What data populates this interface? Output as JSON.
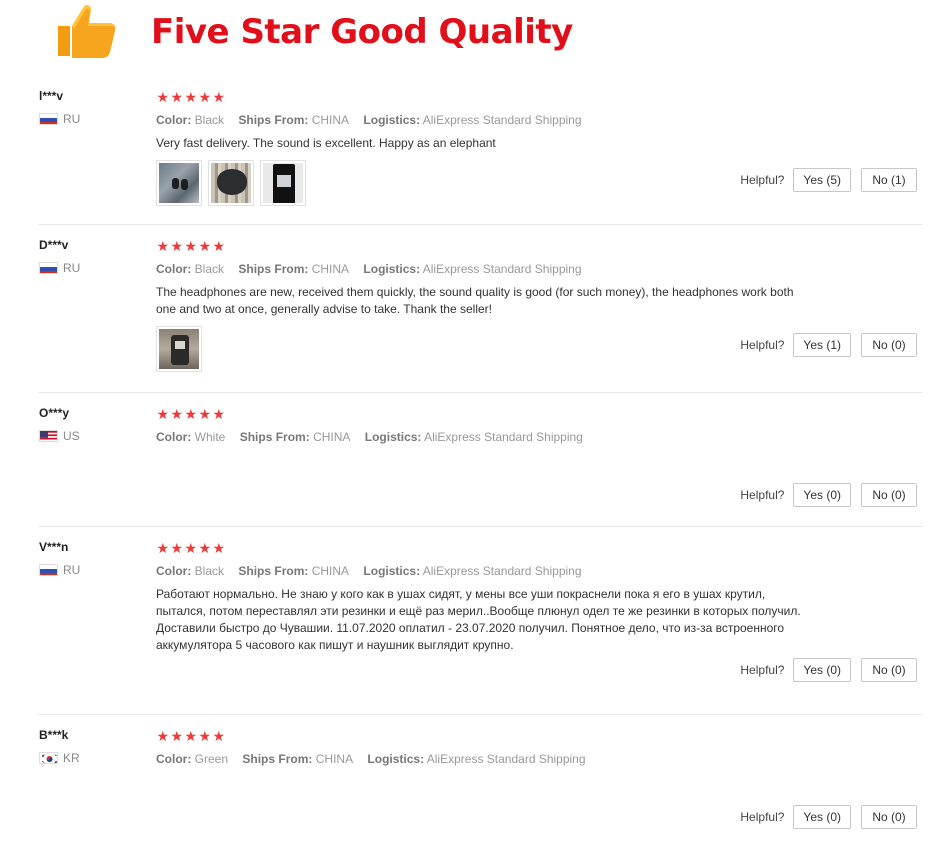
{
  "header": {
    "icon": "thumbs-up-icon",
    "title": "Five Star Good Quality"
  },
  "colors": {
    "title_red": "#e10f1a",
    "star_red": "#ee3a3a",
    "thumb_orange": "#f7a51e"
  },
  "labels": {
    "color": "Color:",
    "ships_from": "Ships From:",
    "logistics": "Logistics:",
    "helpful": "Helpful?"
  },
  "reviews": [
    {
      "user": "l***v",
      "country": "RU",
      "flag": "russia-flag-icon",
      "rating": 5,
      "color": "Black",
      "ships_from": "CHINA",
      "logistics": "AliExpress Standard Shipping",
      "text": "Very fast delivery. The sound is excellent. Happy as an elephant",
      "photo_count": 3,
      "yes": "Yes (5)",
      "no": "No (1)"
    },
    {
      "user": "D***v",
      "country": "RU",
      "flag": "russia-flag-icon",
      "rating": 5,
      "color": "Black",
      "ships_from": "CHINA",
      "logistics": "AliExpress Standard Shipping",
      "text": "The headphones are new, received them quickly, the sound quality is good (for such money), the headphones work both one and two at once, generally advise to take. Thank the seller!",
      "photo_count": 1,
      "yes": "Yes (1)",
      "no": "No (0)"
    },
    {
      "user": "O***y",
      "country": "US",
      "flag": "usa-flag-icon",
      "rating": 5,
      "color": "White",
      "ships_from": "CHINA",
      "logistics": "AliExpress Standard Shipping",
      "text": "",
      "photo_count": 0,
      "yes": "Yes (0)",
      "no": "No (0)"
    },
    {
      "user": "V***n",
      "country": "RU",
      "flag": "russia-flag-icon",
      "rating": 5,
      "color": "Black",
      "ships_from": "CHINA",
      "logistics": "AliExpress Standard Shipping",
      "text": "Работают нормально. Не знаю у кого как в ушах сидят, у мены все уши покраснели пока я его в ушах крутил, пытался, потом переставлял эти резинки и ещё раз мерил..Вообще плюнул одел те же резинки в которых получил. Доставили быстро до Чувашии. 11.07.2020 оплатил - 23.07.2020 получил. Понятное дело, что из-за встроенного аккумулятора 5 часового как пишут и наушник выглядит крупно.",
      "photo_count": 0,
      "yes": "Yes (0)",
      "no": "No (0)"
    },
    {
      "user": "B***k",
      "country": "KR",
      "flag": "korea-flag-icon",
      "rating": 5,
      "color": "Green",
      "ships_from": "CHINA",
      "logistics": "AliExpress Standard Shipping",
      "text": "",
      "photo_count": 0,
      "yes": "Yes (0)",
      "no": "No (0)"
    }
  ]
}
